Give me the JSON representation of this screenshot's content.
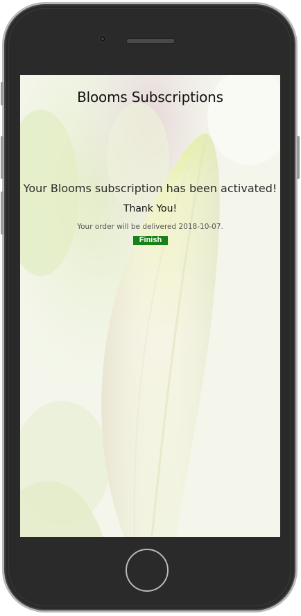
{
  "app": {
    "title": "Blooms Subscriptions"
  },
  "confirmation": {
    "message": "Your Blooms subscription has been activated!",
    "thanks": "Thank You!",
    "delivery_text": "Your order will be delivered 2018-10-07.",
    "finish_label": "Finish"
  },
  "colors": {
    "finish_button": "#188118",
    "device_frame": "#2a2a2a",
    "device_border": "#b9b9b9"
  },
  "icons": {
    "camera": "front-camera-icon",
    "speaker": "speaker-grille-icon",
    "home": "home-button-icon"
  }
}
